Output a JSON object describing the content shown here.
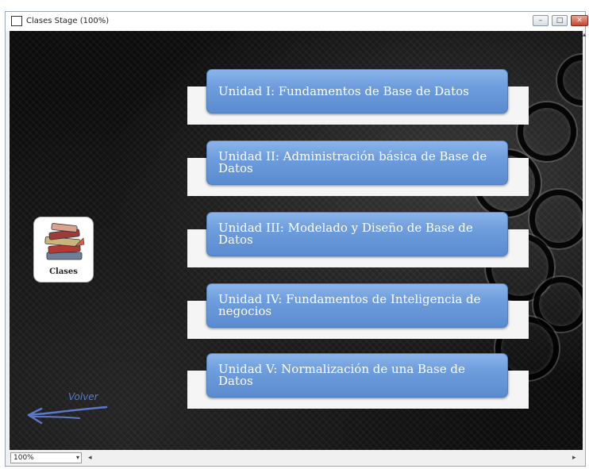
{
  "window": {
    "title": "Clases Stage (100%)",
    "min_label": "–",
    "max_label": "□",
    "close_label": "✕"
  },
  "units": [
    {
      "label": "Unidad I: Fundamentos de Base de Datos"
    },
    {
      "label": "Unidad II: Administración básica de  Base de Datos"
    },
    {
      "label": "Unidad III: Modelado y Diseño de Base de Datos"
    },
    {
      "label": "Unidad IV: Fundamentos de Inteligencia de negocios"
    },
    {
      "label": "Unidad V: Normalización de una Base de Datos"
    }
  ],
  "clases_card": {
    "label": "Clases",
    "icon": "books-icon"
  },
  "back": {
    "label": "Volver",
    "icon": "arrow-left-icon",
    "color": "#5b79c8"
  },
  "statusbar": {
    "zoom": "100%",
    "zoom_arrow": "▾"
  },
  "colors": {
    "unit_button": "#6e9ddd",
    "stage_background": "#0c0c0c",
    "close_button": "#c9452c"
  }
}
